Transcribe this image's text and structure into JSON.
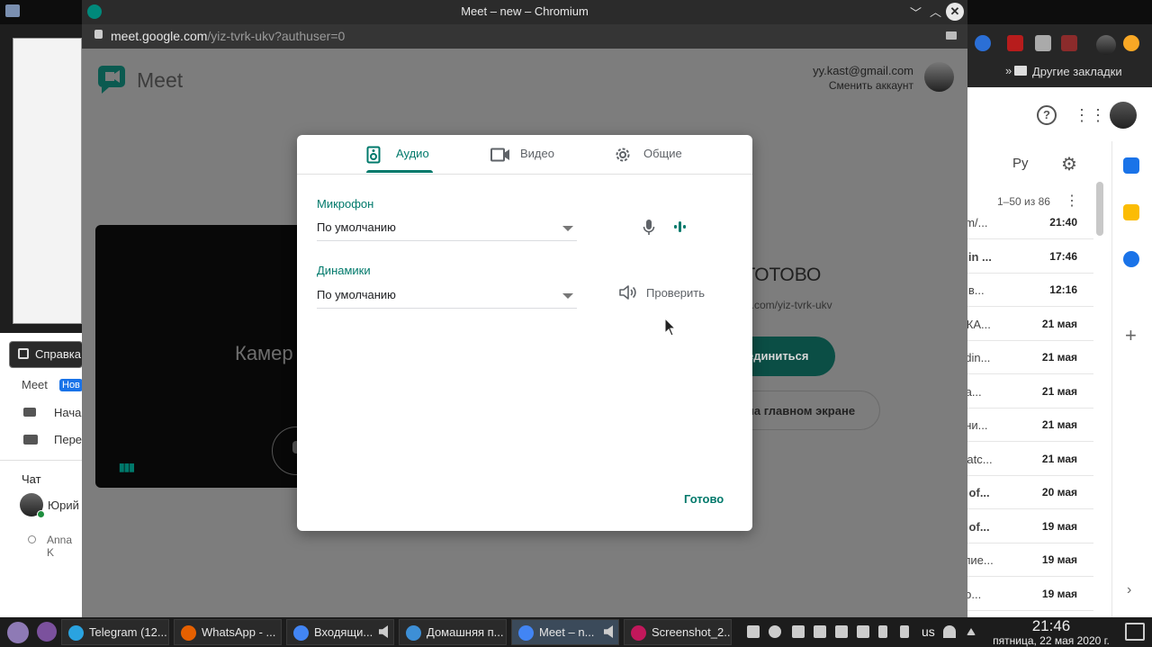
{
  "window": {
    "title": "Meet – new – Chromium",
    "url_host": "meet.google.com",
    "url_path": "/yiz-tvrk-ukv?authuser=0"
  },
  "meet": {
    "brand": "Meet",
    "account_email": "yy.kast@gmail.com",
    "switch_account": "Сменить аккаунт",
    "camera_label": "Камер",
    "ready_fragment": "ГОТОВО",
    "meeting_url_fragment": "e.com/yiz-tvrk-ukv",
    "join_fragment": "единиться",
    "present_fragment": "на главном экране"
  },
  "dialog": {
    "tabs": [
      {
        "label": "Аудио",
        "icon": "speaker-icon",
        "active": true
      },
      {
        "label": "Видео",
        "icon": "videocam-icon",
        "active": false
      },
      {
        "label": "Общие",
        "icon": "gear-icon",
        "active": false
      }
    ],
    "microphone": {
      "title": "Микрофон",
      "value": "По умолчанию"
    },
    "speakers": {
      "title": "Динамики",
      "value": "По умолчанию",
      "test_label": "Проверить"
    },
    "done_label": "Готово"
  },
  "gmail": {
    "bookmarks_label": "Другие закладки",
    "bookmarks_chevron": "»",
    "lang": "Ру",
    "range": "1–50 из 86",
    "rows": [
      {
        "snippet": "om/...",
        "time": "21:40",
        "bold": false
      },
      {
        "snippet": "y in ...",
        "time": "17:46",
        "bold": true
      },
      {
        "snippet": "о в...",
        "time": "12:16",
        "bold": false
      },
      {
        "snippet": "ДКА...",
        "time": "21 мая",
        "bold": false
      },
      {
        "snippet": "adin...",
        "time": "21 мая",
        "bold": false
      },
      {
        "snippet": "да...",
        "time": "21 мая",
        "bold": false
      },
      {
        "snippet": "ени...",
        "time": "21 мая",
        "bold": false
      },
      {
        "snippet": "watc...",
        "time": "21 мая",
        "bold": false
      },
      {
        "snippet": "g of...",
        "time": "20 мая",
        "bold": true
      },
      {
        "snippet": "g of...",
        "time": "19 мая",
        "bold": true
      },
      {
        "snippet": "клие...",
        "time": "19 мая",
        "bold": false
      },
      {
        "snippet": "но...",
        "time": "19 мая",
        "bold": false
      }
    ]
  },
  "left_panel": {
    "help_label": "Справка",
    "meet_label": "Meet",
    "new_badge": "Нов",
    "start_label": "Нача",
    "join_label": "Пере",
    "chat_label": "Чат",
    "user1": "Юрий",
    "user2": "Anna K"
  },
  "taskbar": {
    "tasks": [
      {
        "label": "Telegram (12...",
        "color": "#2aa3e0",
        "active": false,
        "sound": false
      },
      {
        "label": "WhatsApp - ...",
        "color": "#e66000",
        "active": false,
        "sound": false
      },
      {
        "label": "Входящи...",
        "color": "#4285f4",
        "active": false,
        "sound": true
      },
      {
        "label": "Домашняя п...",
        "color": "#3d8fd6",
        "active": false,
        "sound": false
      },
      {
        "label": "Meet – n...",
        "color": "#4285f4",
        "active": true,
        "sound": true
      },
      {
        "label": "Screenshot_2...",
        "color": "#c2185b",
        "active": false,
        "sound": false
      }
    ],
    "lang": "us",
    "time": "21:46",
    "date": "пятница, 22 мая 2020 г."
  }
}
